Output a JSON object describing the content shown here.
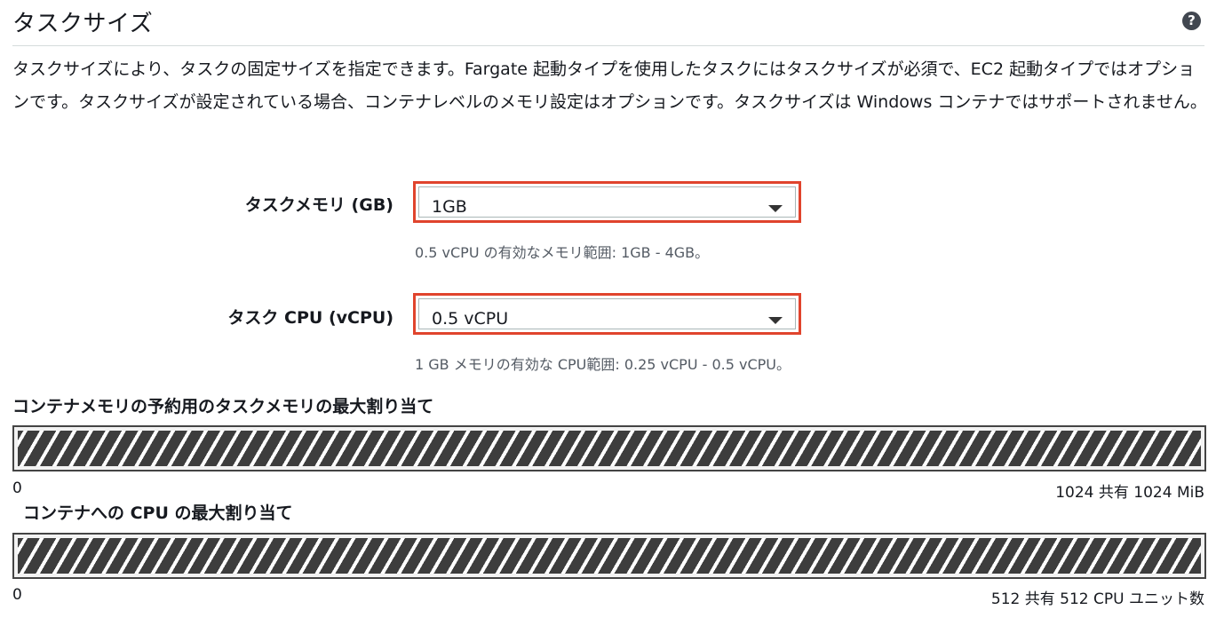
{
  "section": {
    "title": "タスクサイズ",
    "help_icon": "question-circle-icon",
    "description": "タスクサイズにより、タスクの固定サイズを指定できます。Fargate 起動タイプを使用したタスクにはタスクサイズが必須で、EC2 起動タイプではオプションです。タスクサイズが設定されている場合、コンテナレベルのメモリ設定はオプションです。タスクサイズは Windows コンテナではサポートされません。"
  },
  "memory": {
    "label": "タスクメモリ (GB)",
    "selected": "1GB",
    "hint": "0.5 vCPU の有効なメモリ範囲: 1GB - 4GB。"
  },
  "cpu": {
    "label": "タスク CPU (vCPU)",
    "selected": "0.5 vCPU",
    "hint": "1 GB メモリの有効な CPU範囲: 0.25 vCPU - 0.5 vCPU。"
  },
  "memory_allocation": {
    "heading": "コンテナメモリの予約用のタスクメモリの最大割り当て",
    "min_label": "0",
    "max_label": "1024 共有 1024 MiB",
    "fill_fraction": 1.0
  },
  "cpu_allocation": {
    "heading": "コンテナへの CPU の最大割り当て",
    "min_label": "0",
    "max_label": "512 共有 512 CPU ユニット数",
    "fill_fraction": 1.0
  },
  "colors": {
    "highlight_border": "#e0442d",
    "bar_stripe": "#3d3d3d",
    "text": "#16191f",
    "hint_text": "#545b64"
  }
}
